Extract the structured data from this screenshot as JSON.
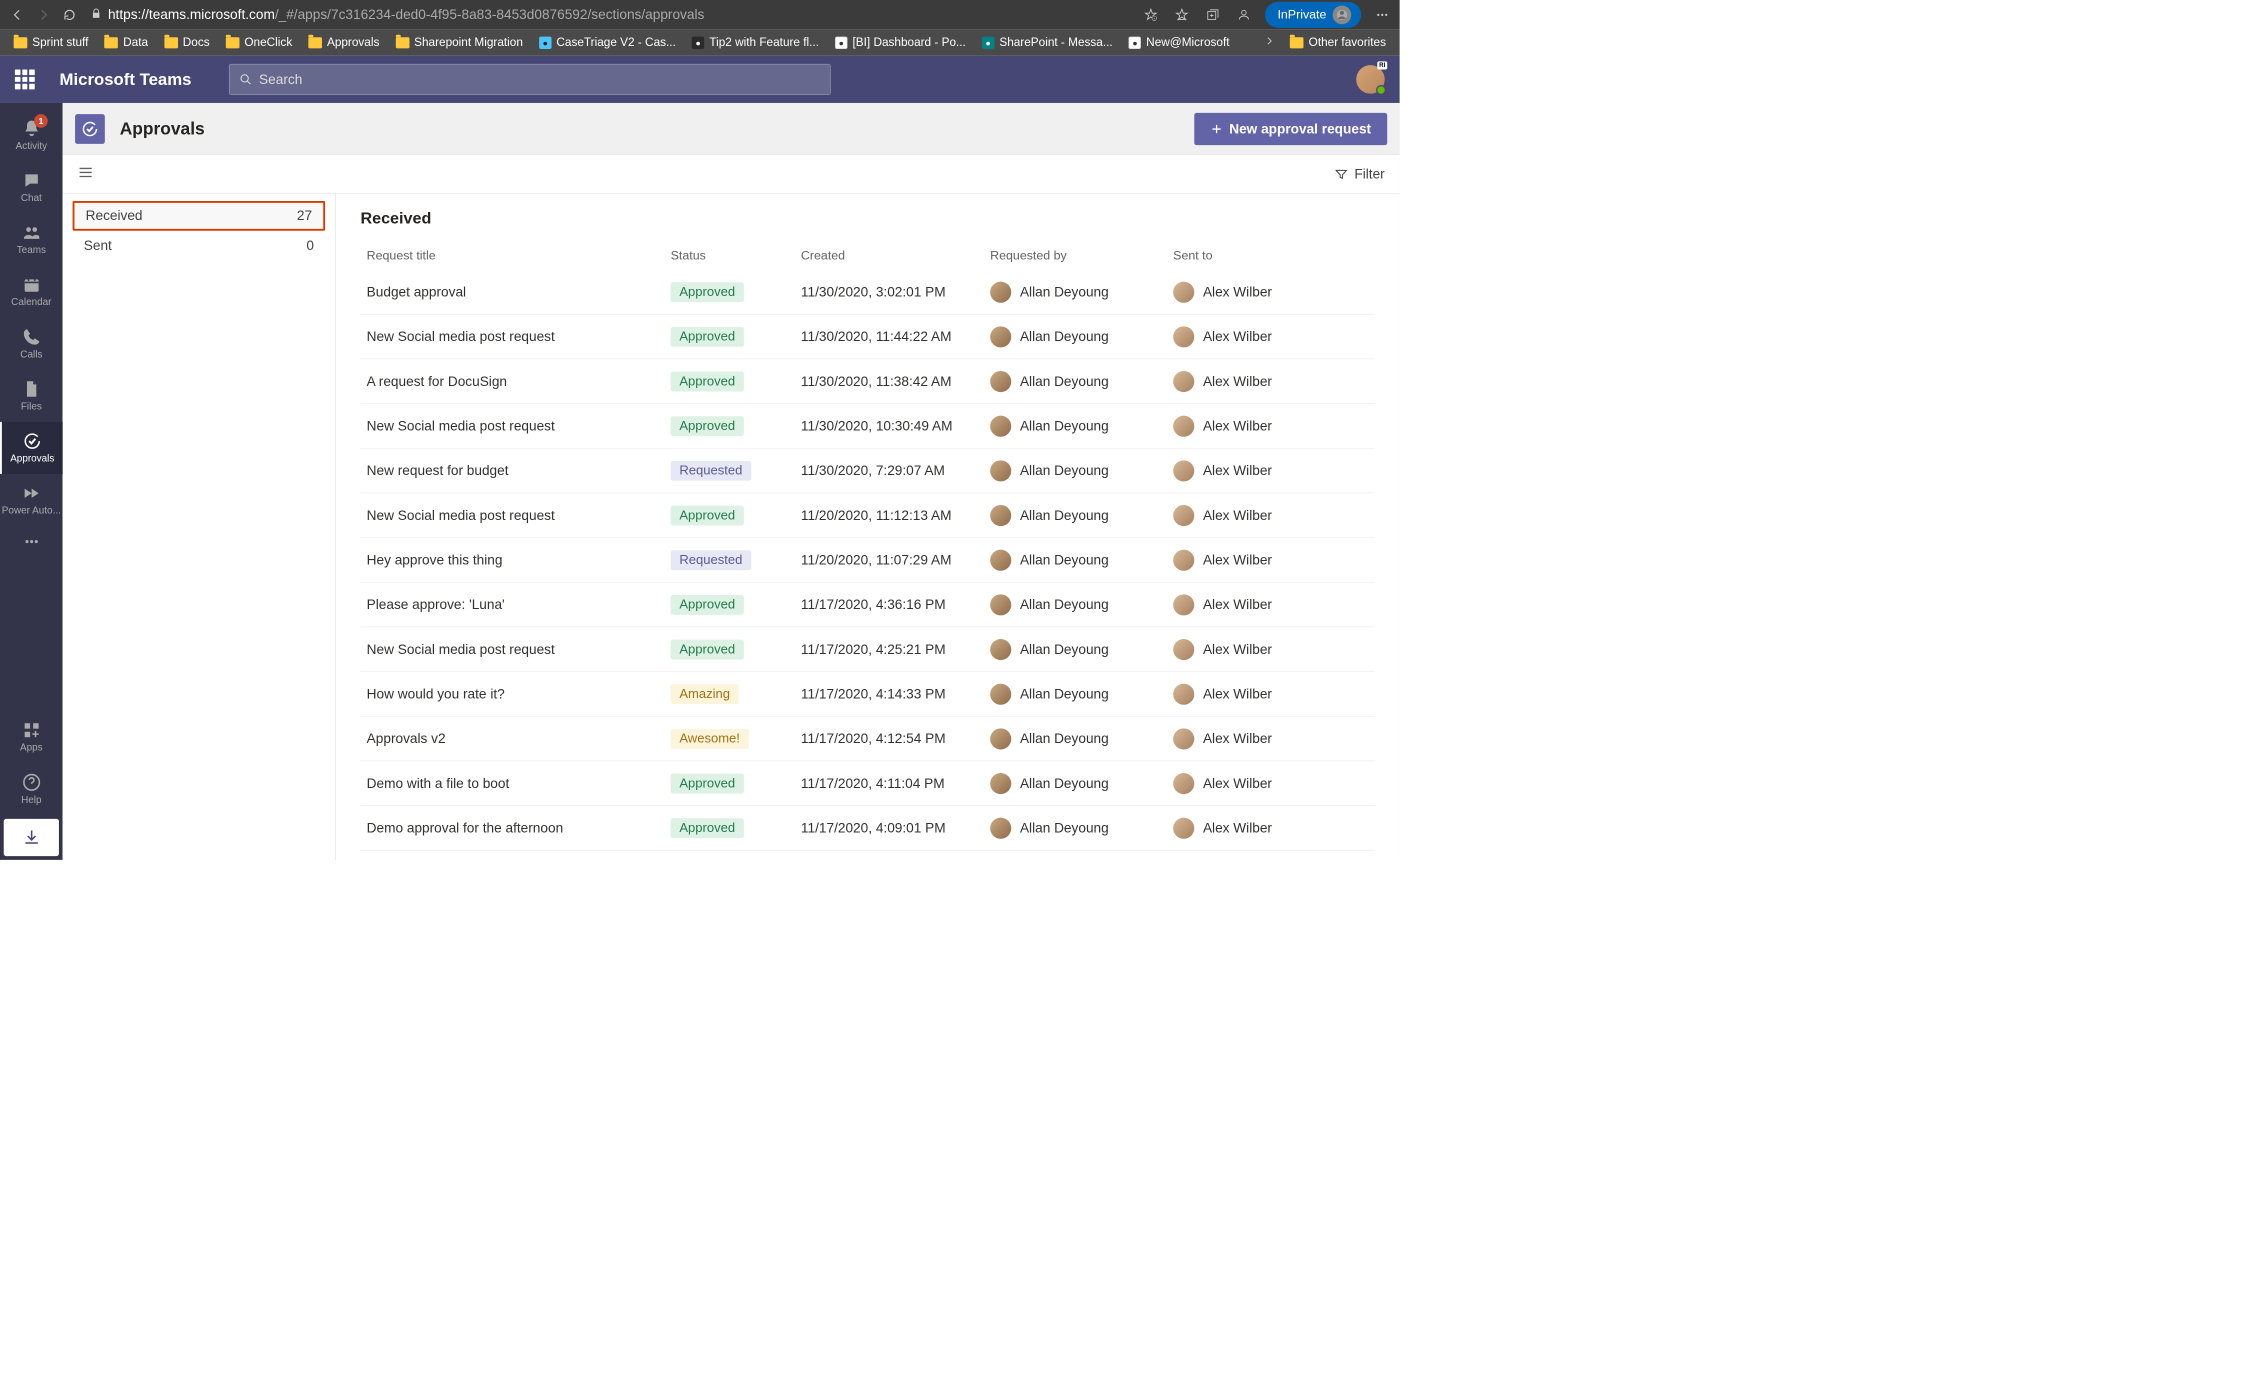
{
  "browser": {
    "url_host": "https://teams.microsoft.com",
    "url_path": "/_#/apps/7c316234-ded0-4f95-8a83-8453d0876592/sections/approvals",
    "inprivate_label": "InPrivate",
    "bookmarks": [
      {
        "label": "Sprint stuff",
        "type": "folder"
      },
      {
        "label": "Data",
        "type": "folder"
      },
      {
        "label": "Docs",
        "type": "folder"
      },
      {
        "label": "OneClick",
        "type": "folder"
      },
      {
        "label": "Approvals",
        "type": "folder"
      },
      {
        "label": "Sharepoint Migration",
        "type": "folder"
      },
      {
        "label": "CaseTriage V2 - Cas...",
        "type": "fav-blue"
      },
      {
        "label": "Tip2 with Feature fl...",
        "type": "fav-dark"
      },
      {
        "label": "[BI] Dashboard - Po...",
        "type": "fav-white"
      },
      {
        "label": "SharePoint - Messa...",
        "type": "fav-green"
      },
      {
        "label": "New@Microsoft",
        "type": "fav-white"
      }
    ],
    "other_favorites": "Other favorites"
  },
  "teams": {
    "title": "Microsoft Teams",
    "search_placeholder": "Search"
  },
  "rail": {
    "items": [
      {
        "label": "Activity",
        "badge": "1"
      },
      {
        "label": "Chat"
      },
      {
        "label": "Teams"
      },
      {
        "label": "Calendar"
      },
      {
        "label": "Calls"
      },
      {
        "label": "Files"
      },
      {
        "label": "Approvals"
      },
      {
        "label": "Power Auto..."
      }
    ],
    "apps_label": "Apps",
    "help_label": "Help"
  },
  "page": {
    "title": "Approvals",
    "new_request_label": "New approval request",
    "filter_label": "Filter"
  },
  "folders": [
    {
      "label": "Received",
      "count": "27",
      "highlighted": true
    },
    {
      "label": "Sent",
      "count": "0"
    }
  ],
  "table": {
    "heading": "Received",
    "columns": {
      "title": "Request title",
      "status": "Status",
      "created": "Created",
      "requester": "Requested by",
      "sentto": "Sent to"
    },
    "rows": [
      {
        "title": "Budget approval",
        "status": "Approved",
        "status_class": "status-approved",
        "created": "11/30/2020, 3:02:01 PM",
        "requester": "Allan Deyoung",
        "sentto": "Alex Wilber"
      },
      {
        "title": "New Social media post request",
        "status": "Approved",
        "status_class": "status-approved",
        "created": "11/30/2020, 11:44:22 AM",
        "requester": "Allan Deyoung",
        "sentto": "Alex Wilber"
      },
      {
        "title": "A request for DocuSign",
        "status": "Approved",
        "status_class": "status-approved",
        "created": "11/30/2020, 11:38:42 AM",
        "requester": "Allan Deyoung",
        "sentto": "Alex Wilber"
      },
      {
        "title": "New Social media post request",
        "status": "Approved",
        "status_class": "status-approved",
        "created": "11/30/2020, 10:30:49 AM",
        "requester": "Allan Deyoung",
        "sentto": "Alex Wilber"
      },
      {
        "title": "New request for budget",
        "status": "Requested",
        "status_class": "status-requested",
        "created": "11/30/2020, 7:29:07 AM",
        "requester": "Allan Deyoung",
        "sentto": "Alex Wilber"
      },
      {
        "title": "New Social media post request",
        "status": "Approved",
        "status_class": "status-approved",
        "created": "11/20/2020, 11:12:13 AM",
        "requester": "Allan Deyoung",
        "sentto": "Alex Wilber"
      },
      {
        "title": "Hey approve this thing",
        "status": "Requested",
        "status_class": "status-requested",
        "created": "11/20/2020, 11:07:29 AM",
        "requester": "Allan Deyoung",
        "sentto": "Alex Wilber"
      },
      {
        "title": "Please approve: 'Luna'",
        "status": "Approved",
        "status_class": "status-approved",
        "created": "11/17/2020, 4:36:16 PM",
        "requester": "Allan Deyoung",
        "sentto": "Alex Wilber"
      },
      {
        "title": "New Social media post request",
        "status": "Approved",
        "status_class": "status-approved",
        "created": "11/17/2020, 4:25:21 PM",
        "requester": "Allan Deyoung",
        "sentto": "Alex Wilber"
      },
      {
        "title": "How would you rate it?",
        "status": "Amazing",
        "status_class": "status-amazing",
        "created": "11/17/2020, 4:14:33 PM",
        "requester": "Allan Deyoung",
        "sentto": "Alex Wilber"
      },
      {
        "title": "Approvals v2",
        "status": "Awesome!",
        "status_class": "status-awesome",
        "created": "11/17/2020, 4:12:54 PM",
        "requester": "Allan Deyoung",
        "sentto": "Alex Wilber"
      },
      {
        "title": "Demo with a file to boot",
        "status": "Approved",
        "status_class": "status-approved",
        "created": "11/17/2020, 4:11:04 PM",
        "requester": "Allan Deyoung",
        "sentto": "Alex Wilber"
      },
      {
        "title": "Demo approval for the afternoon",
        "status": "Approved",
        "status_class": "status-approved",
        "created": "11/17/2020, 4:09:01 PM",
        "requester": "Allan Deyoung",
        "sentto": "Alex Wilber"
      }
    ]
  }
}
